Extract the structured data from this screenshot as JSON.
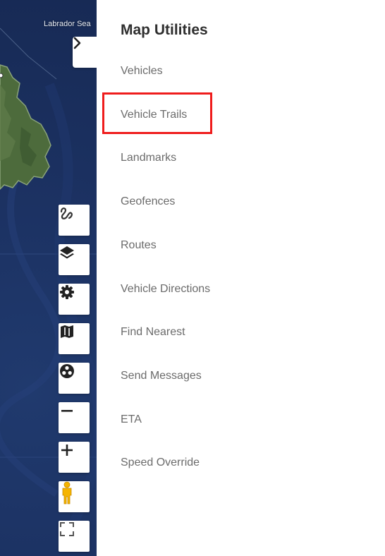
{
  "map": {
    "label": "Labrador Sea",
    "toggle_icon": "chevron-right-icon",
    "controls": [
      {
        "name": "trail-tool-button",
        "icon": "squiggle-icon"
      },
      {
        "name": "layers-button",
        "icon": "layers-icon"
      },
      {
        "name": "settings-button",
        "icon": "gear-icon"
      },
      {
        "name": "map-type-button",
        "icon": "map-icon"
      },
      {
        "name": "cluster-button",
        "icon": "cluster-icon"
      },
      {
        "name": "zoom-out-button",
        "icon": "minus-icon"
      },
      {
        "name": "zoom-in-button",
        "icon": "plus-icon"
      },
      {
        "name": "street-view-button",
        "icon": "pegman-icon"
      },
      {
        "name": "fullscreen-button",
        "icon": "fullscreen-icon"
      }
    ]
  },
  "panel": {
    "title": "Map Utilities",
    "items": [
      {
        "label": "Vehicles"
      },
      {
        "label": "Vehicle Trails",
        "highlighted": true
      },
      {
        "label": "Landmarks"
      },
      {
        "label": "Geofences"
      },
      {
        "label": "Routes"
      },
      {
        "label": "Vehicle Directions"
      },
      {
        "label": "Find Nearest"
      },
      {
        "label": "Send Messages"
      },
      {
        "label": "ETA"
      },
      {
        "label": "Speed Override"
      }
    ]
  },
  "colors": {
    "highlight": "#ef1c1c",
    "ocean": "#1c3263",
    "land": "#4d6b3c",
    "menu_text": "#6b6b6b",
    "title_text": "#2f2f2f"
  }
}
